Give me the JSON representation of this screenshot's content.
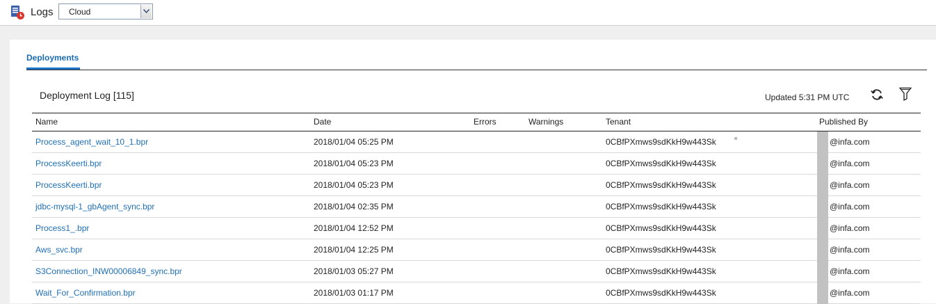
{
  "app": {
    "title": "Logs"
  },
  "source_select": {
    "value": "Cloud"
  },
  "tabs": [
    {
      "label": "Deployments"
    }
  ],
  "log": {
    "title": "Deployment Log [115]",
    "updated": "Updated 5:31 PM UTC"
  },
  "table": {
    "columns": [
      "Name",
      "Date",
      "Errors",
      "Warnings",
      "Tenant",
      "Published By"
    ],
    "rows": [
      {
        "name": "Process_agent_wait_10_1.bpr",
        "date": "2018/01/04 05:25 PM",
        "errors": "",
        "warnings": "",
        "tenant": "0CBfPXmws9sdKkH9w443Sk",
        "published_by": "@infa.com"
      },
      {
        "name": "ProcessKeerti.bpr",
        "date": "2018/01/04 05:23 PM",
        "errors": "",
        "warnings": "",
        "tenant": "0CBfPXmws9sdKkH9w443Sk",
        "published_by": "@infa.com"
      },
      {
        "name": "ProcessKeerti.bpr",
        "date": "2018/01/04 05:23 PM",
        "errors": "",
        "warnings": "",
        "tenant": "0CBfPXmws9sdKkH9w443Sk",
        "published_by": "@infa.com"
      },
      {
        "name": "jdbc-mysql-1_gbAgent_sync.bpr",
        "date": "2018/01/04 02:35 PM",
        "errors": "",
        "warnings": "",
        "tenant": "0CBfPXmws9sdKkH9w443Sk",
        "published_by": "@infa.com"
      },
      {
        "name": "Process1_.bpr",
        "date": "2018/01/04 12:52 PM",
        "errors": "",
        "warnings": "",
        "tenant": "0CBfPXmws9sdKkH9w443Sk",
        "published_by": "@infa.com"
      },
      {
        "name": "Aws_svc.bpr",
        "date": "2018/01/04 12:25 PM",
        "errors": "",
        "warnings": "",
        "tenant": "0CBfPXmws9sdKkH9w443Sk",
        "published_by": "@infa.com"
      },
      {
        "name": "S3Connection_INW00006849_sync.bpr",
        "date": "2018/01/03 05:27 PM",
        "errors": "",
        "warnings": "",
        "tenant": "0CBfPXmws9sdKkH9w443Sk",
        "published_by": "@infa.com"
      },
      {
        "name": "Wait_For_Confirmation.bpr",
        "date": "2018/01/03 01:17 PM",
        "errors": "",
        "warnings": "",
        "tenant": "0CBfPXmws9sdKkH9w443Sk",
        "published_by": "@infa.com"
      }
    ]
  },
  "icons": {
    "app": "logs-icon",
    "refresh": "refresh-icon",
    "filter": "filter-icon",
    "dropdown": "chevron-down-icon"
  },
  "colors": {
    "link": "#1f6fb5",
    "tab_active": "#1d74c6",
    "background": "#efefef"
  }
}
